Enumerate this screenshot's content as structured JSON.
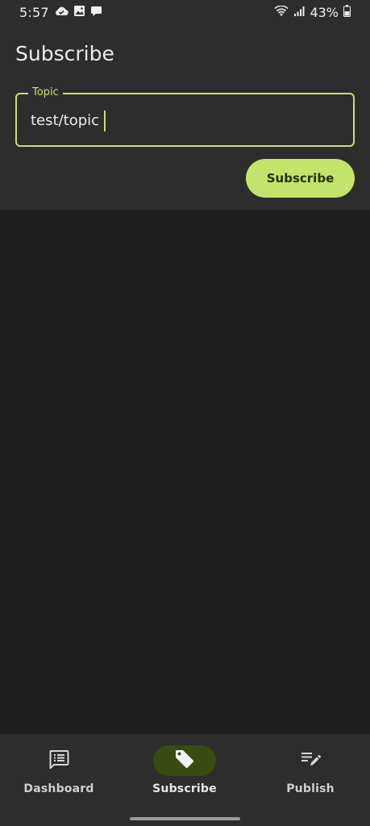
{
  "status_bar": {
    "time": "5:57",
    "battery": "43%",
    "icons": [
      "cloud-icon",
      "image-icon",
      "chat-bubble-icon",
      "wifi-icon",
      "signal-icon",
      "battery-icon"
    ]
  },
  "header": {
    "title": "Subscribe"
  },
  "topic_field": {
    "label": "Topic",
    "value": "test/topic"
  },
  "subscribe_button": {
    "label": "Subscribe"
  },
  "bottom_nav": {
    "items": [
      {
        "label": "Dashboard",
        "icon": "dashboard-icon"
      },
      {
        "label": "Subscribe",
        "icon": "tag-icon",
        "active": true
      },
      {
        "label": "Publish",
        "icon": "publish-icon"
      }
    ]
  },
  "colors": {
    "accent": "#c4e36a",
    "surface": "#2d2d2d",
    "background": "#1e1e1e",
    "active_pill": "#3b4a10"
  }
}
